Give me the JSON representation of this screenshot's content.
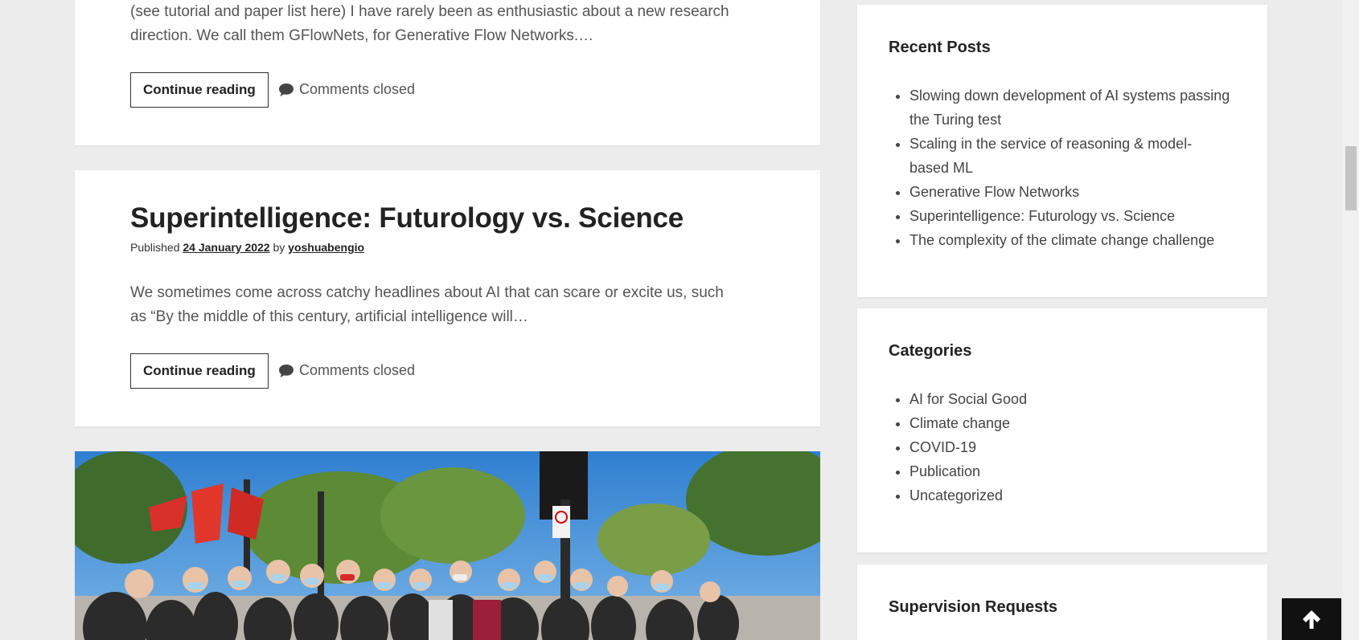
{
  "posts": [
    {
      "excerpt_line1": "(see tutorial and paper list here) I have rarely been as enthusiastic about a new research",
      "excerpt_line2": "direction. We call them GFlowNets, for Generative Flow Networks.…",
      "continue_label": "Continue reading",
      "comments_label": "Comments closed"
    },
    {
      "title": "Superintelligence: Futurology vs. Science",
      "meta_published": "Published",
      "meta_date": "24 January 2022",
      "meta_by": "by",
      "meta_author": "yoshuabengio",
      "excerpt_line1": "We sometimes come across catchy headlines about AI that can scare or excite us, such",
      "excerpt_line2": "as “By the middle of this century, artificial intelligence will…",
      "continue_label": "Continue reading",
      "comments_label": "Comments closed"
    }
  ],
  "sidebar": {
    "recent_posts": {
      "title": "Recent Posts",
      "items": [
        {
          "label": "Slowing down development of AI systems passing the Turing test"
        },
        {
          "label": "Scaling in the service of reasoning & model-based ML"
        },
        {
          "label": "Generative Flow Networks"
        },
        {
          "label": "Superintelligence: Futurology vs. Science"
        },
        {
          "label": "The complexity of the climate change challenge"
        }
      ]
    },
    "categories": {
      "title": "Categories",
      "items": [
        {
          "label": "AI for Social Good"
        },
        {
          "label": "Climate change"
        },
        {
          "label": "COVID-19"
        },
        {
          "label": "Publication"
        },
        {
          "label": "Uncategorized"
        }
      ]
    },
    "supervision": {
      "title": "Supervision Requests"
    }
  },
  "icons": {
    "comment": "comment-icon",
    "back_to_top": "arrow-up-icon"
  },
  "colors": {
    "page_bg": "#ececec",
    "card_bg": "#ffffff",
    "text_dark": "#222222",
    "text_body": "#555555",
    "to_top_bg": "#111111",
    "sky": "#3d8fd8"
  }
}
